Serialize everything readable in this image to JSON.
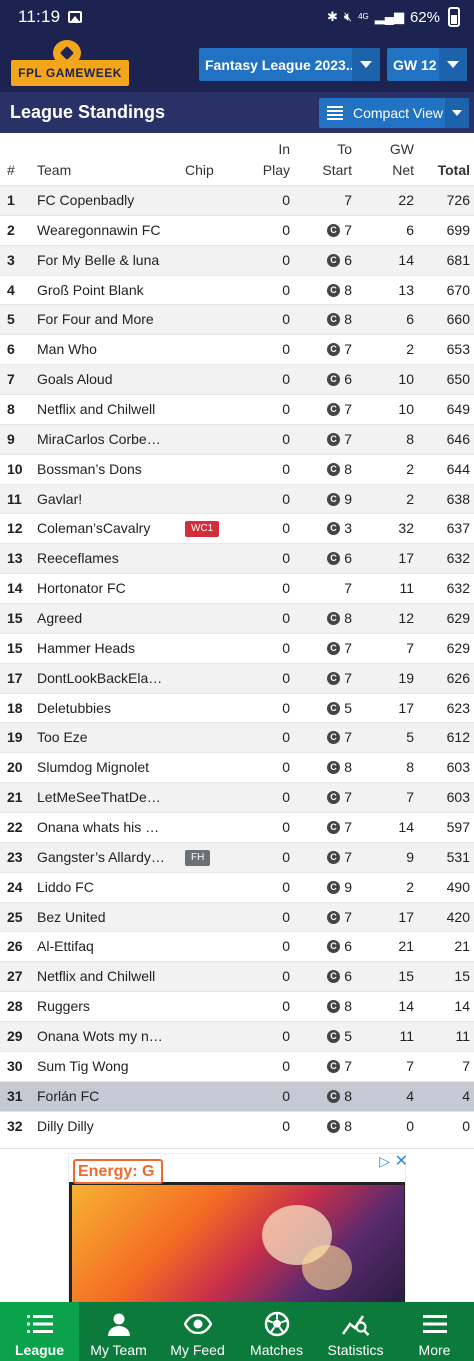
{
  "status_bar": {
    "time": "11:19",
    "battery": "62%",
    "network": "4G"
  },
  "header": {
    "logo_text": "FPL GAMEWEEK",
    "league_select": "Fantasy League 2023...",
    "gameweek_select": "GW 12"
  },
  "section": {
    "title": "League Standings",
    "view_button": "Compact View"
  },
  "table": {
    "columns": {
      "rank": "#",
      "team": "Team",
      "chip": "Chip",
      "in_play_1": "In",
      "in_play_2": "Play",
      "to_start_1": "To",
      "to_start_2": "Start",
      "gw_net_1": "GW",
      "gw_net_2": "Net",
      "total": "Total"
    },
    "captain_badge": "C",
    "rows": [
      {
        "rank": "1",
        "team": "FC Copenbadly",
        "chip": "",
        "in_play": "0",
        "captain": false,
        "to_start": "7",
        "gw_net": "22",
        "total": "726"
      },
      {
        "rank": "2",
        "team": "Wearegonnawin FC",
        "chip": "",
        "in_play": "0",
        "captain": true,
        "to_start": "7",
        "gw_net": "6",
        "total": "699"
      },
      {
        "rank": "3",
        "team": "For My Belle & luna",
        "chip": "",
        "in_play": "0",
        "captain": true,
        "to_start": "6",
        "gw_net": "14",
        "total": "681"
      },
      {
        "rank": "4",
        "team": "Groß Point Blank",
        "chip": "",
        "in_play": "0",
        "captain": true,
        "to_start": "8",
        "gw_net": "13",
        "total": "670"
      },
      {
        "rank": "5",
        "team": "For Four and More",
        "chip": "",
        "in_play": "0",
        "captain": true,
        "to_start": "8",
        "gw_net": "6",
        "total": "660"
      },
      {
        "rank": "6",
        "team": "Man Who",
        "chip": "",
        "in_play": "0",
        "captain": true,
        "to_start": "7",
        "gw_net": "2",
        "total": "653"
      },
      {
        "rank": "7",
        "team": "Goals Aloud",
        "chip": "",
        "in_play": "0",
        "captain": true,
        "to_start": "6",
        "gw_net": "10",
        "total": "650"
      },
      {
        "rank": "8",
        "team": "Netflix and Chilwell",
        "chip": "",
        "in_play": "0",
        "captain": true,
        "to_start": "7",
        "gw_net": "10",
        "total": "649"
      },
      {
        "rank": "9",
        "team": "MiraCarlos Corberan",
        "chip": "",
        "in_play": "0",
        "captain": true,
        "to_start": "7",
        "gw_net": "8",
        "total": "646"
      },
      {
        "rank": "10",
        "team": "Bossman’s Dons",
        "chip": "",
        "in_play": "0",
        "captain": true,
        "to_start": "8",
        "gw_net": "2",
        "total": "644"
      },
      {
        "rank": "11",
        "team": "Gavlar!",
        "chip": "",
        "in_play": "0",
        "captain": true,
        "to_start": "9",
        "gw_net": "2",
        "total": "638"
      },
      {
        "rank": "12",
        "team": "Coleman’sCavalry",
        "chip": "WC1",
        "chip_color": "#d32f3a",
        "in_play": "0",
        "captain": true,
        "to_start": "3",
        "gw_net": "32",
        "total": "637"
      },
      {
        "rank": "13",
        "team": "Reeceflames",
        "chip": "",
        "in_play": "0",
        "captain": true,
        "to_start": "6",
        "gw_net": "17",
        "total": "632"
      },
      {
        "rank": "14",
        "team": "Hortonator FC",
        "chip": "",
        "in_play": "0",
        "captain": false,
        "to_start": "7",
        "gw_net": "11",
        "total": "632"
      },
      {
        "rank": "15",
        "team": "Agreed",
        "chip": "",
        "in_play": "0",
        "captain": true,
        "to_start": "8",
        "gw_net": "12",
        "total": "629"
      },
      {
        "rank": "15",
        "team": "Hammer Heads",
        "chip": "",
        "in_play": "0",
        "captain": true,
        "to_start": "7",
        "gw_net": "7",
        "total": "629"
      },
      {
        "rank": "17",
        "team": "DontLookBackElanger",
        "chip": "",
        "in_play": "0",
        "captain": true,
        "to_start": "7",
        "gw_net": "19",
        "total": "626"
      },
      {
        "rank": "18",
        "team": "Deletubbies",
        "chip": "",
        "in_play": "0",
        "captain": true,
        "to_start": "5",
        "gw_net": "17",
        "total": "623"
      },
      {
        "rank": "19",
        "team": "Too Eze",
        "chip": "",
        "in_play": "0",
        "captain": true,
        "to_start": "7",
        "gw_net": "5",
        "total": "612"
      },
      {
        "rank": "20",
        "team": "Slumdog Mignolet",
        "chip": "",
        "in_play": "0",
        "captain": true,
        "to_start": "8",
        "gw_net": "8",
        "total": "603"
      },
      {
        "rank": "21",
        "team": "LetMeSeeThatDeJong",
        "chip": "",
        "in_play": "0",
        "captain": true,
        "to_start": "7",
        "gw_net": "7",
        "total": "603"
      },
      {
        "rank": "22",
        "team": "Onana whats his name",
        "chip": "",
        "in_play": "0",
        "captain": true,
        "to_start": "7",
        "gw_net": "14",
        "total": "597"
      },
      {
        "rank": "23",
        "team": "Gangster’s Allardyce",
        "chip": "FH",
        "chip_color": "#6b7179",
        "in_play": "0",
        "captain": true,
        "to_start": "7",
        "gw_net": "9",
        "total": "531"
      },
      {
        "rank": "24",
        "team": "Liddo FC",
        "chip": "",
        "in_play": "0",
        "captain": true,
        "to_start": "9",
        "gw_net": "2",
        "total": "490"
      },
      {
        "rank": "25",
        "team": "Bez United",
        "chip": "",
        "in_play": "0",
        "captain": true,
        "to_start": "7",
        "gw_net": "17",
        "total": "420"
      },
      {
        "rank": "26",
        "team": "Al-Ettifaq",
        "chip": "",
        "in_play": "0",
        "captain": true,
        "to_start": "6",
        "gw_net": "21",
        "total": "21"
      },
      {
        "rank": "27",
        "team": "Netflix and Chilwell",
        "chip": "",
        "in_play": "0",
        "captain": true,
        "to_start": "6",
        "gw_net": "15",
        "total": "15"
      },
      {
        "rank": "28",
        "team": "Ruggers",
        "chip": "",
        "in_play": "0",
        "captain": true,
        "to_start": "8",
        "gw_net": "14",
        "total": "14"
      },
      {
        "rank": "29",
        "team": "Onana Wots my name",
        "chip": "",
        "in_play": "0",
        "captain": true,
        "to_start": "5",
        "gw_net": "11",
        "total": "11"
      },
      {
        "rank": "30",
        "team": "Sum Tig Wong",
        "chip": "",
        "in_play": "0",
        "captain": true,
        "to_start": "7",
        "gw_net": "7",
        "total": "7"
      },
      {
        "rank": "31",
        "team": "Forlán FC",
        "chip": "",
        "in_play": "0",
        "captain": true,
        "to_start": "8",
        "gw_net": "4",
        "total": "4",
        "highlight": true
      },
      {
        "rank": "32",
        "team": "Dilly Dilly",
        "chip": "",
        "in_play": "0",
        "captain": true,
        "to_start": "8",
        "gw_net": "0",
        "total": "0"
      }
    ]
  },
  "ad": {
    "brand": "Energy: G"
  },
  "bottom_nav": {
    "items": [
      {
        "label": "League",
        "icon": "list-icon",
        "active": true
      },
      {
        "label": "My Team",
        "icon": "person-icon",
        "active": false
      },
      {
        "label": "My Feed",
        "icon": "eye-icon",
        "active": false
      },
      {
        "label": "Matches",
        "icon": "football-icon",
        "active": false
      },
      {
        "label": "Statistics",
        "icon": "stats-icon",
        "active": false
      },
      {
        "label": "More",
        "icon": "menu-icon",
        "active": false
      }
    ]
  },
  "colors": {
    "primary_dark": "#1c2351",
    "accent_blue": "#2272c4",
    "nav_green": "#0b7a3a",
    "nav_active": "#0aa24a",
    "logo_orange": "#f4a61a"
  }
}
